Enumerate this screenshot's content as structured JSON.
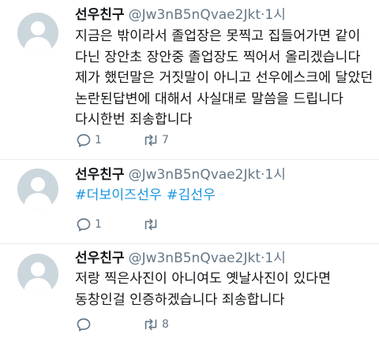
{
  "tweets": [
    {
      "name": "선우친구",
      "handle": "@Jw3nB5nQvae2Jkt",
      "separator": "·",
      "time": "1시",
      "text": "지금은 밖이라서 졸업장은 못찍고 집들어가면 같이 다닌 장안초 장안중 졸업장도 찍어서 올리겠습니다 제가 했던말은 거짓말이 아니고 선우에스크에 달았던 논란된답변에 대해서 사실대로 말씀을 드립니다 다시한번 죄송합니다",
      "hashtags": [],
      "reply_count": "1",
      "retweet_count": "7"
    },
    {
      "name": "선우친구",
      "handle": "@Jw3nB5nQvae2Jkt",
      "separator": "·",
      "time": "1시",
      "text": "",
      "hashtags": [
        "#더보이즈선우",
        "#김선우"
      ],
      "reply_count": "1",
      "retweet_count": ""
    },
    {
      "name": "선우친구",
      "handle": "@Jw3nB5nQvae2Jkt",
      "separator": "·",
      "time": "1시",
      "text": "저랑 찍은사진이 아니여도 옛날사진이 있다면 동창인걸 인증하겠습니다 죄송합니다",
      "hashtags": [],
      "reply_count": "",
      "retweet_count": "8"
    }
  ],
  "icons": {
    "reply": "reply-icon",
    "retweet": "retweet-icon",
    "avatar": "default-avatar-icon"
  },
  "colors": {
    "text": "#14171a",
    "secondary": "#657786",
    "hashtag": "#1b95e0",
    "avatar_bg": "#ccd6dd",
    "avatar_fg": "#ffffff",
    "divider": "#e6ecf0"
  }
}
